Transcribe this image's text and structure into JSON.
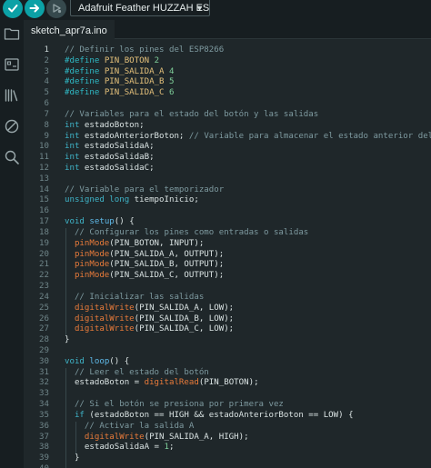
{
  "toolbar": {
    "verify_icon": "check-icon",
    "upload_icon": "arrow-right-icon",
    "debug_icon": "debug-icon",
    "board": "Adafruit Feather HUZZAH ES…",
    "colors": {
      "accent": "#0ca1a6",
      "background": "#171e21",
      "editor": "#1f272a"
    }
  },
  "sidebar": {
    "icons": [
      "folder-icon",
      "board-manager-icon",
      "library-icon",
      "debug-icon",
      "search-icon"
    ]
  },
  "tabs": [
    {
      "label": "sketch_apr7a.ino",
      "active": true
    }
  ],
  "editor": {
    "current_line": 1,
    "lines": [
      [
        [
          "c-com",
          "// Definir los pines del ESP8266"
        ]
      ],
      [
        [
          "c-pre",
          "#define "
        ],
        [
          "c-mac",
          "PIN_BOTON"
        ],
        [
          "c-num",
          " 2"
        ]
      ],
      [
        [
          "c-pre",
          "#define "
        ],
        [
          "c-mac",
          "PIN_SALIDA_A"
        ],
        [
          "c-num",
          " 4"
        ]
      ],
      [
        [
          "c-pre",
          "#define "
        ],
        [
          "c-mac",
          "PIN_SALIDA_B"
        ],
        [
          "c-num",
          " 5"
        ]
      ],
      [
        [
          "c-pre",
          "#define "
        ],
        [
          "c-mac",
          "PIN_SALIDA_C"
        ],
        [
          "c-num",
          " 6"
        ]
      ],
      [],
      [
        [
          "c-com",
          "// Variables para el estado del botón y las salidas"
        ]
      ],
      [
        [
          "c-key",
          "int"
        ],
        [
          "",
          " estadoBoton;"
        ]
      ],
      [
        [
          "c-key",
          "int"
        ],
        [
          "",
          " estadoAnteriorBoton; "
        ],
        [
          "c-com",
          "// Variable para almacenar el estado anterior del botón"
        ]
      ],
      [
        [
          "c-key",
          "int"
        ],
        [
          "",
          " estadoSalidaA;"
        ]
      ],
      [
        [
          "c-key",
          "int"
        ],
        [
          "",
          " estadoSalidaB;"
        ]
      ],
      [
        [
          "c-key",
          "int"
        ],
        [
          "",
          " estadoSalidaC;"
        ]
      ],
      [],
      [
        [
          "c-com",
          "// Variable para el temporizador"
        ]
      ],
      [
        [
          "c-key",
          "unsigned long"
        ],
        [
          "",
          " tiempoInicio;"
        ]
      ],
      [],
      [
        [
          "c-key",
          "void"
        ],
        [
          "",
          " "
        ],
        [
          "c-kw2",
          "setup"
        ],
        [
          "",
          "() {"
        ]
      ],
      [
        [
          "",
          "  "
        ],
        [
          "c-com",
          "// Configurar los pines como entradas o salidas"
        ]
      ],
      [
        [
          "",
          "  "
        ],
        [
          "c-fn",
          "pinMode"
        ],
        [
          "",
          "(PIN_BOTON, INPUT);"
        ]
      ],
      [
        [
          "",
          "  "
        ],
        [
          "c-fn",
          "pinMode"
        ],
        [
          "",
          "(PIN_SALIDA_A, OUTPUT);"
        ]
      ],
      [
        [
          "",
          "  "
        ],
        [
          "c-fn",
          "pinMode"
        ],
        [
          "",
          "(PIN_SALIDA_B, OUTPUT);"
        ]
      ],
      [
        [
          "",
          "  "
        ],
        [
          "c-fn",
          "pinMode"
        ],
        [
          "",
          "(PIN_SALIDA_C, OUTPUT);"
        ]
      ],
      [],
      [
        [
          "",
          "  "
        ],
        [
          "c-com",
          "// Inicializar las salidas"
        ]
      ],
      [
        [
          "",
          "  "
        ],
        [
          "c-fn",
          "digitalWrite"
        ],
        [
          "",
          "(PIN_SALIDA_A, LOW);"
        ]
      ],
      [
        [
          "",
          "  "
        ],
        [
          "c-fn",
          "digitalWrite"
        ],
        [
          "",
          "(PIN_SALIDA_B, LOW);"
        ]
      ],
      [
        [
          "",
          "  "
        ],
        [
          "c-fn",
          "digitalWrite"
        ],
        [
          "",
          "(PIN_SALIDA_C, LOW);"
        ]
      ],
      [
        [
          "",
          "}"
        ]
      ],
      [],
      [
        [
          "c-key",
          "void"
        ],
        [
          "",
          " "
        ],
        [
          "c-kw2",
          "loop"
        ],
        [
          "",
          "() {"
        ]
      ],
      [
        [
          "",
          "  "
        ],
        [
          "c-com",
          "// Leer el estado del botón"
        ]
      ],
      [
        [
          "",
          "  estadoBoton = "
        ],
        [
          "c-fn",
          "digitalRead"
        ],
        [
          "",
          "(PIN_BOTON);"
        ]
      ],
      [],
      [
        [
          "",
          "  "
        ],
        [
          "c-com",
          "// Si el botón se presiona por primera vez"
        ]
      ],
      [
        [
          "",
          "  "
        ],
        [
          "c-key",
          "if"
        ],
        [
          "",
          " (estadoBoton == HIGH && estadoAnteriorBoton == LOW) {"
        ]
      ],
      [
        [
          "",
          "    "
        ],
        [
          "c-com",
          "// Activar la salida A"
        ]
      ],
      [
        [
          "",
          "    "
        ],
        [
          "c-fn",
          "digitalWrite"
        ],
        [
          "",
          "(PIN_SALIDA_A, HIGH);"
        ]
      ],
      [
        [
          "",
          "    estadoSalidaA = "
        ],
        [
          "c-num",
          "1"
        ],
        [
          "",
          ";"
        ]
      ],
      [
        [
          "",
          "  }"
        ]
      ],
      [],
      []
    ]
  }
}
